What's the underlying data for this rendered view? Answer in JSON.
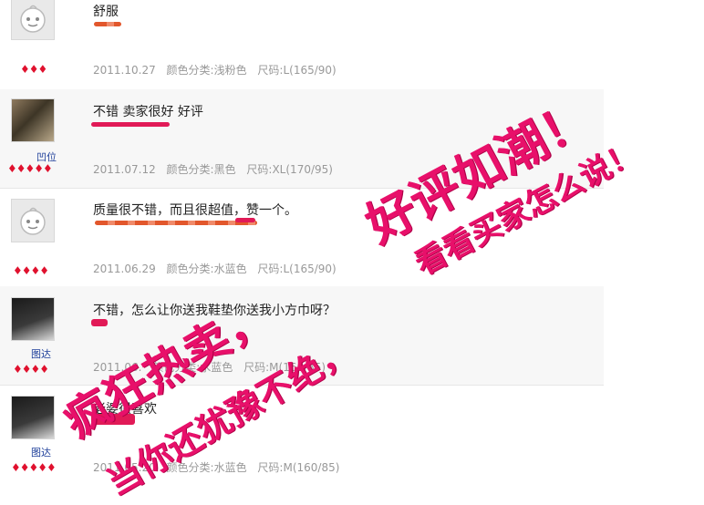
{
  "reviews": [
    {
      "comment": "舒服",
      "username": "",
      "hearts": "♦♦♦",
      "date": "2011.10.27",
      "color": "颜色分类:浅粉色",
      "size": "尺码:L(165/90)"
    },
    {
      "comment": "不错 卖家很好 好评",
      "username": "凹位",
      "hearts": "♦♦♦♦♦",
      "date": "2011.07.12",
      "color": "颜色分类:黑色",
      "size": "尺码:XL(170/95)"
    },
    {
      "comment": "质量很不错，而且很超值，赞一个。",
      "username": "",
      "hearts": "♦♦♦♦",
      "date": "2011.06.29",
      "color": "颜色分类:水蓝色",
      "size": "尺码:L(165/90)"
    },
    {
      "comment": "不错，怎么让你送我鞋垫你送我小方巾呀？",
      "username": "图达",
      "hearts": "♦♦♦♦",
      "date": "2011.06.",
      "color": "颜色分类:水蓝色",
      "size": "尺码:M(160/85)"
    },
    {
      "comment": "老婆很喜欢",
      "username": "图达",
      "hearts": "♦♦♦♦♦",
      "date": "2011.05.20",
      "color": "颜色分类:水蓝色",
      "size": "尺码:M(160/85)"
    }
  ],
  "overlay": {
    "line1": "好评如潮！",
    "line2": "看看买家怎么说！",
    "line3": "疯狂热卖，",
    "line4": "当你还犹豫不绝，"
  },
  "colors": {
    "accent": "#e8106a",
    "link": "#1e3f9a",
    "meta": "#999999"
  }
}
